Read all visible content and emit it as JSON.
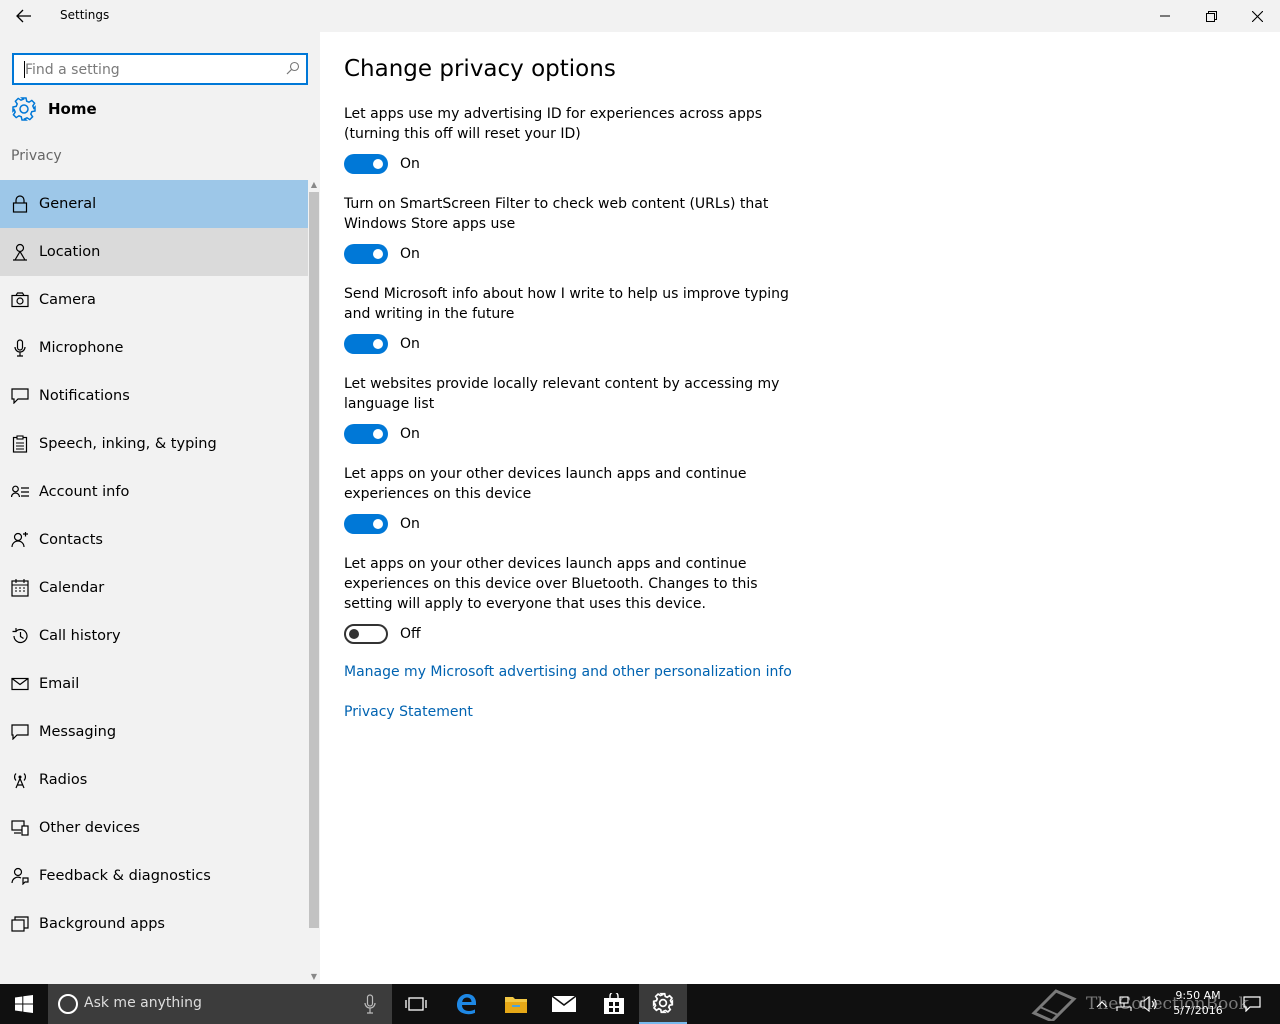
{
  "window": {
    "title": "Settings"
  },
  "sidebar": {
    "search_placeholder": "Find a setting",
    "home_label": "Home",
    "section_label": "Privacy",
    "items": [
      {
        "label": "General",
        "icon": "lock-icon",
        "state": "selected"
      },
      {
        "label": "Location",
        "icon": "location-icon",
        "state": "hover"
      },
      {
        "label": "Camera",
        "icon": "camera-icon",
        "state": "normal"
      },
      {
        "label": "Microphone",
        "icon": "microphone-icon",
        "state": "normal"
      },
      {
        "label": "Notifications",
        "icon": "notifications-icon",
        "state": "normal"
      },
      {
        "label": "Speech, inking, & typing",
        "icon": "clipboard-icon",
        "state": "normal"
      },
      {
        "label": "Account info",
        "icon": "account-info-icon",
        "state": "normal"
      },
      {
        "label": "Contacts",
        "icon": "contacts-icon",
        "state": "normal"
      },
      {
        "label": "Calendar",
        "icon": "calendar-icon",
        "state": "normal"
      },
      {
        "label": "Call history",
        "icon": "history-icon",
        "state": "normal"
      },
      {
        "label": "Email",
        "icon": "email-icon",
        "state": "normal"
      },
      {
        "label": "Messaging",
        "icon": "messaging-icon",
        "state": "normal"
      },
      {
        "label": "Radios",
        "icon": "radio-antenna-icon",
        "state": "normal"
      },
      {
        "label": "Other devices",
        "icon": "devices-icon",
        "state": "normal"
      },
      {
        "label": "Feedback & diagnostics",
        "icon": "feedback-icon",
        "state": "normal"
      },
      {
        "label": "Background apps",
        "icon": "background-apps-icon",
        "state": "normal"
      }
    ]
  },
  "main": {
    "title": "Change privacy options",
    "options": [
      {
        "description": "Let apps use my advertising ID for experiences across apps (turning this off will reset your ID)",
        "state": "On",
        "on": true
      },
      {
        "description": "Turn on SmartScreen Filter to check web content (URLs) that Windows Store apps use",
        "state": "On",
        "on": true
      },
      {
        "description": "Send Microsoft info about how I write to help us improve typing and writing in the future",
        "state": "On",
        "on": true
      },
      {
        "description": "Let websites provide locally relevant content by accessing my language list",
        "state": "On",
        "on": true
      },
      {
        "description": "Let apps on your other devices launch apps and continue experiences on this device",
        "state": "On",
        "on": true
      },
      {
        "description": "Let apps on your other devices launch apps and continue experiences on this device over Bluetooth. Changes to this setting will apply to everyone that uses this device.",
        "state": "Off",
        "on": false
      }
    ],
    "links": {
      "manage": "Manage my Microsoft advertising and other personalization info",
      "privacy": "Privacy Statement"
    }
  },
  "taskbar": {
    "search_text": "Ask me anything",
    "time": "9:50 AM",
    "date": "5/7/2016",
    "watermark": "TheCollectionBook"
  },
  "colors": {
    "accent": "#0078d7",
    "selected_nav": "#9dc7e8",
    "link": "#0063b1"
  }
}
